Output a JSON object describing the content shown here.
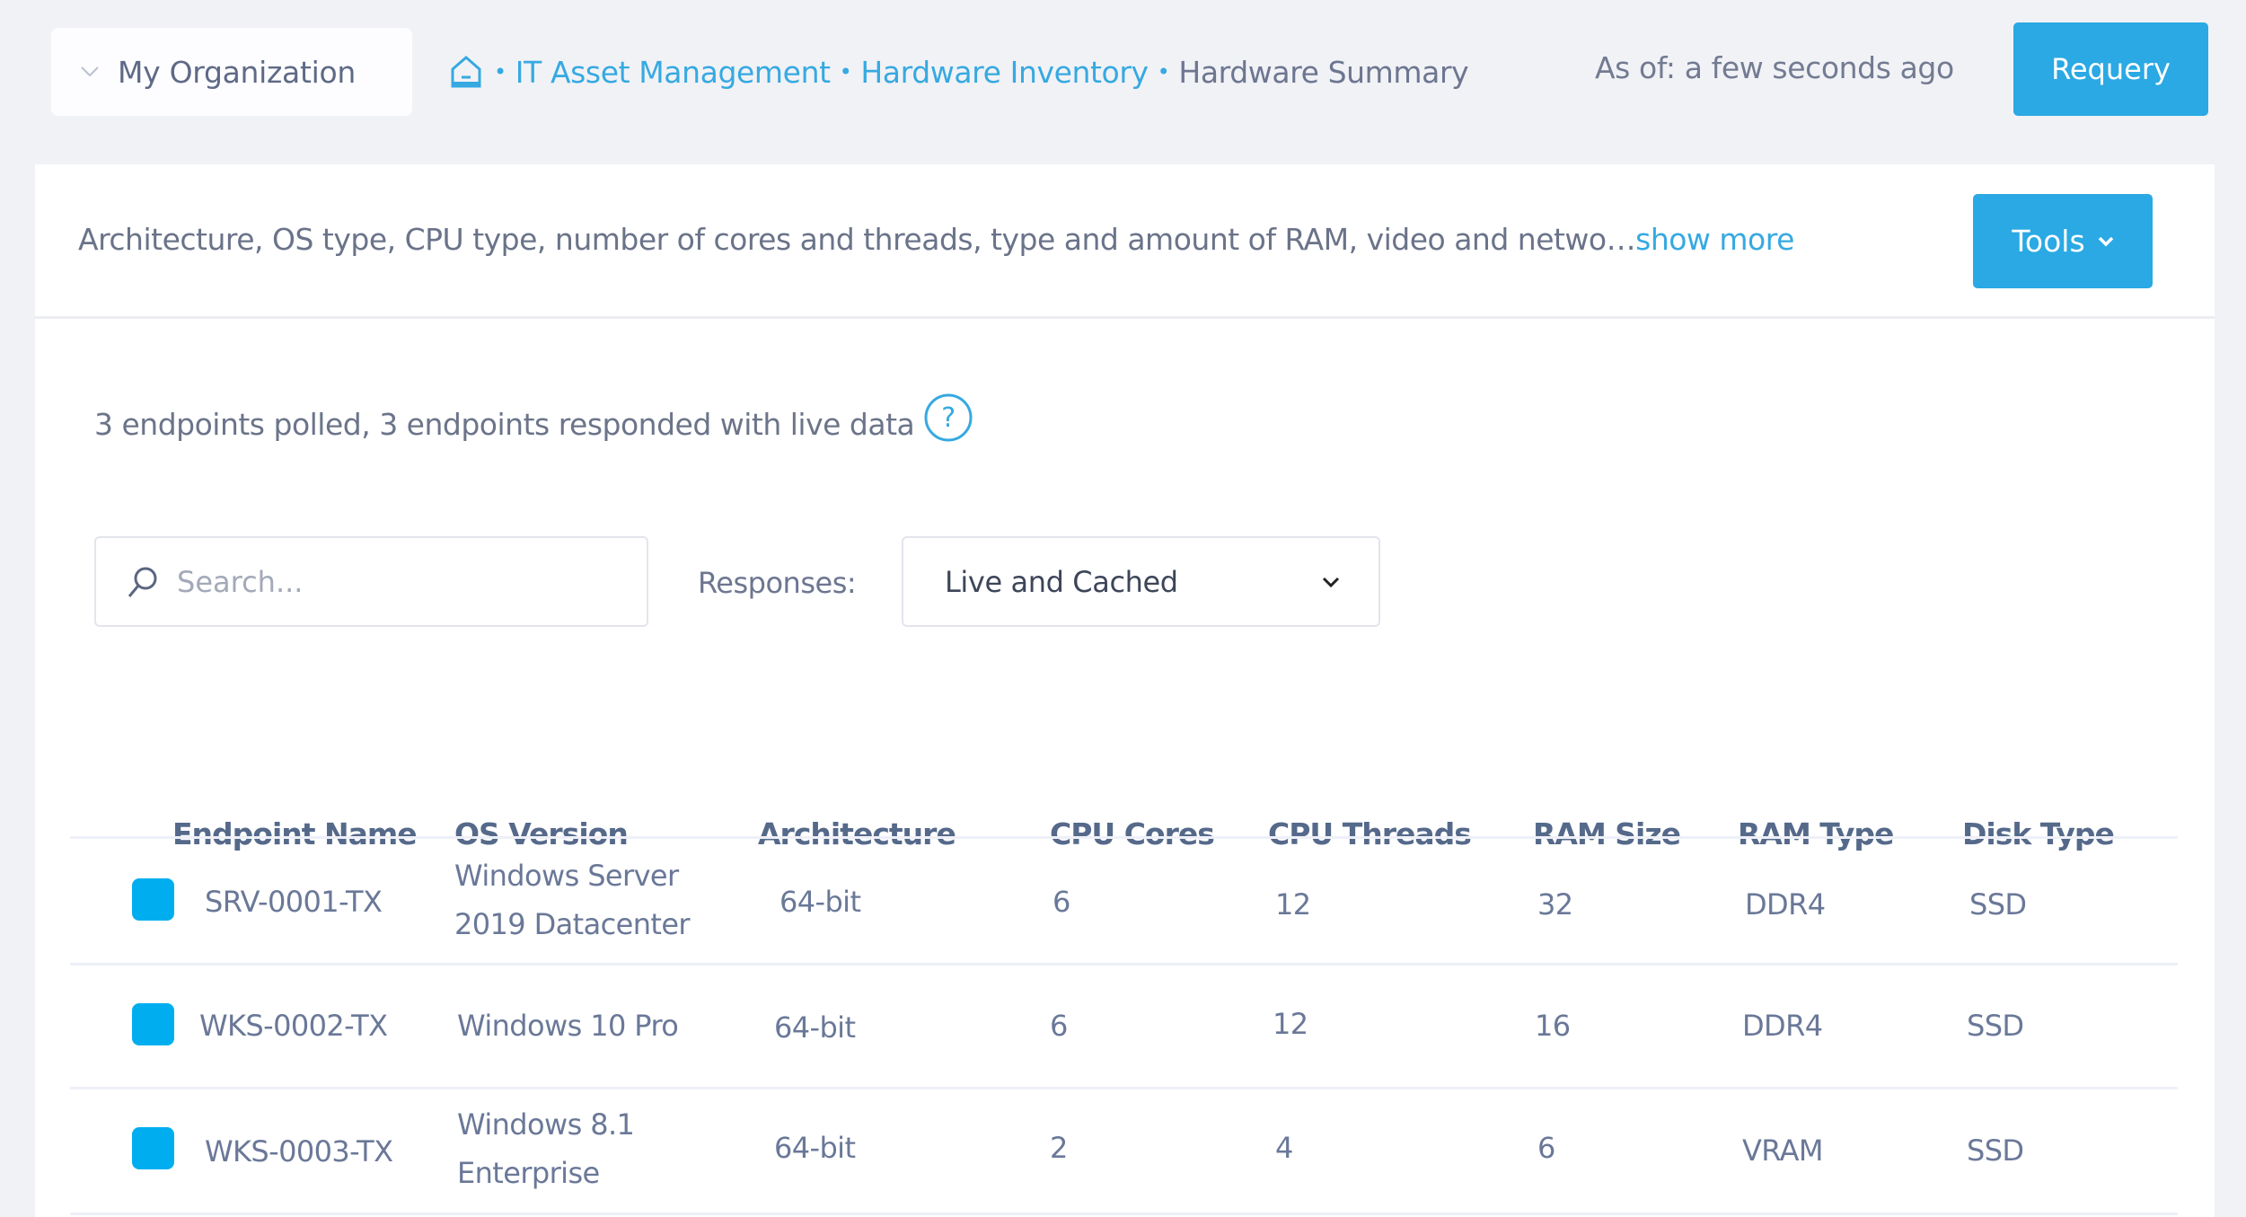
{
  "topbar": {
    "org_label": "My Organization",
    "breadcrumb": {
      "home_icon": "home-icon",
      "items": [
        {
          "label": "IT Asset Management",
          "link": true
        },
        {
          "label": "Hardware Inventory",
          "link": true
        },
        {
          "label": "Hardware Summary",
          "link": false
        }
      ],
      "separator": "•"
    },
    "as_of": "As of: a few seconds ago",
    "requery_label": "Requery"
  },
  "card": {
    "description": "Architecture, OS type, CPU type, number of cores and threads, type and amount of RAM, video and netwo…",
    "show_more_label": "show more",
    "tools_label": "Tools",
    "status_text": "3 endpoints polled, 3 endpoints responded with live data",
    "help_icon_glyph": "?",
    "search": {
      "placeholder": "Search...",
      "value": ""
    },
    "responses_label": "Responses:",
    "responses_selected": "Live and Cached"
  },
  "colors": {
    "accent": "#2aa9e4",
    "status_indicator": "#00aeef",
    "link": "#36a9e1",
    "header_text": "#55698a"
  },
  "table": {
    "columns": [
      "Endpoint Name",
      "OS Version",
      "Architecture",
      "CPU Cores",
      "CPU Threads",
      "RAM Size",
      "RAM Type",
      "Disk Type"
    ],
    "rows": [
      {
        "endpoint": "SRV-0001-TX",
        "os": "Windows Server 2019 Datacenter",
        "arch": "64-bit",
        "cores": "6",
        "threads": "12",
        "ram_size": "32",
        "ram_type": "DDR4",
        "disk": "SSD"
      },
      {
        "endpoint": "WKS-0002-TX",
        "os": "Windows 10 Pro",
        "arch": "64-bit",
        "cores": "6",
        "threads": "12",
        "ram_size": "16",
        "ram_type": "DDR4",
        "disk": "SSD"
      },
      {
        "endpoint": "WKS-0003-TX",
        "os": "Windows 8.1 Enterprise",
        "arch": "64-bit",
        "cores": "2",
        "threads": "4",
        "ram_size": "6",
        "ram_type": "VRAM",
        "disk": "SSD"
      }
    ]
  }
}
